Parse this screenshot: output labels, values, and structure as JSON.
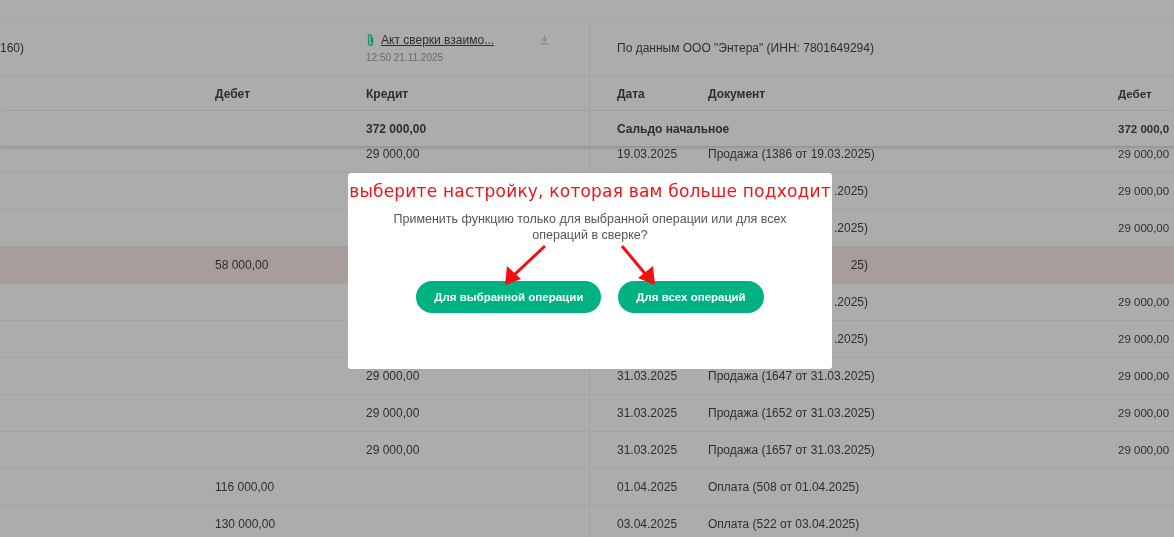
{
  "header": {
    "left_title": "160)",
    "attachment": {
      "name": "Акт сверки взаимо...",
      "time": "12:50 21.11.2025"
    },
    "right_title": "По данным ООО \"Энтера\" (ИНН: 7801649294)"
  },
  "columns_left": [
    "Дебет",
    "Кредит"
  ],
  "columns_right": [
    "Дата",
    "Документ",
    "Дебет"
  ],
  "opening": {
    "credit": "372 000,00",
    "label": "Сальдо начальное",
    "debit": "372 000,0"
  },
  "rows": [
    {
      "kind": "full",
      "highlighted": false,
      "credit": "29 000,00",
      "date": "19.03.2025",
      "document": "Продажа (1386 от 19.03.2025)",
      "right_debit": "29 000,00"
    },
    {
      "kind": "covered",
      "highlighted": false,
      "document": ".2025)",
      "right_debit": "29 000,00"
    },
    {
      "kind": "covered",
      "highlighted": false,
      "document": ".2025)",
      "right_debit": "29 000,00"
    },
    {
      "kind": "covered",
      "highlighted": true,
      "debit": "58 000,00",
      "document": "25)"
    },
    {
      "kind": "covered",
      "highlighted": false,
      "document": ".2025)",
      "right_debit": "29 000,00"
    },
    {
      "kind": "covered",
      "highlighted": false,
      "document": ".2025)",
      "right_debit": "29 000,00"
    },
    {
      "kind": "full",
      "highlighted": false,
      "credit": "29 000,00",
      "date": "31.03.2025",
      "document": "Продажа (1647 от 31.03.2025)",
      "right_debit": "29 000,00"
    },
    {
      "kind": "full",
      "highlighted": false,
      "credit": "29 000,00",
      "date": "31.03.2025",
      "document": "Продажа (1652 от 31.03.2025)",
      "right_debit": "29 000,00"
    },
    {
      "kind": "full",
      "highlighted": false,
      "credit": "29 000,00",
      "date": "31.03.2025",
      "document": "Продажа (1657 от 31.03.2025)",
      "right_debit": "29 000,00"
    },
    {
      "kind": "full",
      "highlighted": false,
      "debit": "116 000,00",
      "date": "01.04.2025",
      "document": "Оплата (508 от 01.04.2025)"
    },
    {
      "kind": "full",
      "highlighted": false,
      "debit": "130 000,00",
      "date": "03.04.2025",
      "document": "Оплата (522 от 03.04.2025)"
    }
  ],
  "dialog": {
    "hint": "выберите настройку, которая вам больше подходит",
    "question": "Применить функцию только для выбранной операции или для всех операций в сверке?",
    "buttons": [
      "Для выбранной операции",
      "Для всех операций"
    ]
  }
}
